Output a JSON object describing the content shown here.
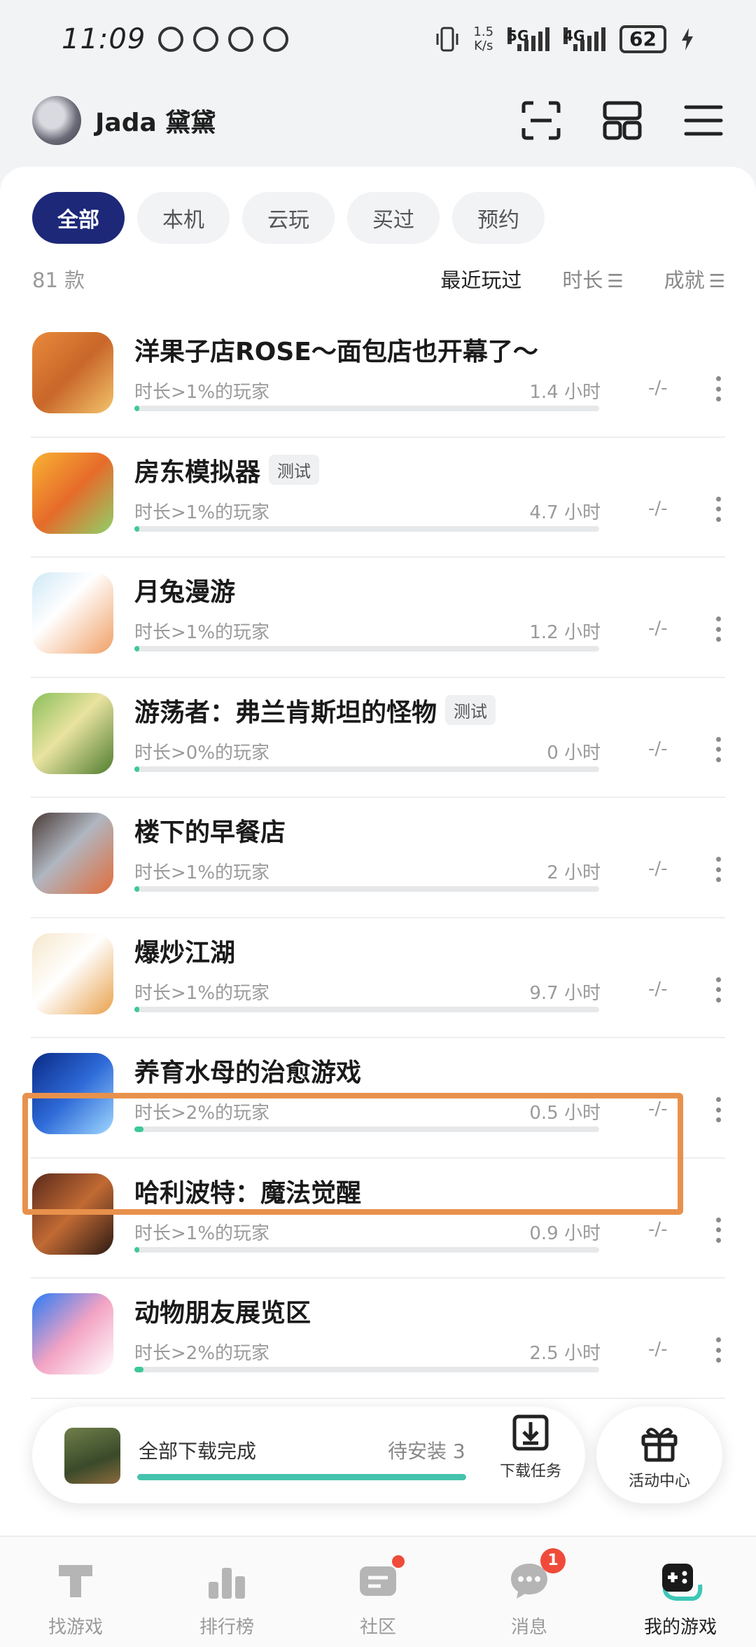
{
  "status_bar": {
    "time": "11:09",
    "net_speed_value": "1.5",
    "net_speed_unit": "K/s",
    "signal_1": "5G",
    "signal_2": "4G",
    "battery": "62"
  },
  "header": {
    "user_name": "Jada 黛黛"
  },
  "filters": [
    "全部",
    "本机",
    "云玩",
    "买过",
    "预约"
  ],
  "list_meta": {
    "count": "81 款",
    "sort_recent": "最近玩过",
    "sort_duration": "时长",
    "sort_achievement": "成就"
  },
  "games": [
    {
      "title": "洋果子店ROSE～面包店也开幕了～",
      "tag": "",
      "sub": "时长>1%的玩家",
      "hours": "1.4 小时",
      "ach": "-/-",
      "progress": 0.01
    },
    {
      "title": "房东模拟器",
      "tag": "测试",
      "sub": "时长>1%的玩家",
      "hours": "4.7 小时",
      "ach": "-/-",
      "progress": 0.01
    },
    {
      "title": "月兔漫游",
      "tag": "",
      "sub": "时长>1%的玩家",
      "hours": "1.2 小时",
      "ach": "-/-",
      "progress": 0.01
    },
    {
      "title": "游荡者：弗兰肯斯坦的怪物",
      "tag": "测试",
      "sub": "时长>0%的玩家",
      "hours": "0 小时",
      "ach": "-/-",
      "progress": 0.0
    },
    {
      "title": "楼下的早餐店",
      "tag": "",
      "sub": "时长>1%的玩家",
      "hours": "2 小时",
      "ach": "-/-",
      "progress": 0.01
    },
    {
      "title": "爆炒江湖",
      "tag": "",
      "sub": "时长>1%的玩家",
      "hours": "9.7 小时",
      "ach": "-/-",
      "progress": 0.01
    },
    {
      "title": "养育水母的治愈游戏",
      "tag": "",
      "sub": "时长>2%的玩家",
      "hours": "0.5 小时",
      "ach": "-/-",
      "progress": 0.02
    },
    {
      "title": "哈利波特：魔法觉醒",
      "tag": "",
      "sub": "时长>1%的玩家",
      "hours": "0.9 小时",
      "ach": "-/-",
      "progress": 0.01
    },
    {
      "title": "动物朋友展览区",
      "tag": "",
      "sub": "时长>2%的玩家",
      "hours": "2.5 小时",
      "ach": "-/-",
      "progress": 0.02
    }
  ],
  "download_bar": {
    "title": "全部下载完成",
    "pending": "待安装 3",
    "task_label": "下载任务",
    "progress": 1.0
  },
  "activity": {
    "label": "活动中心"
  },
  "bottom_nav": [
    {
      "label": "找游戏",
      "icon": "find-games-icon"
    },
    {
      "label": "排行榜",
      "icon": "ranking-icon"
    },
    {
      "label": "社区",
      "icon": "community-icon"
    },
    {
      "label": "消息",
      "icon": "message-icon",
      "badge": "1"
    },
    {
      "label": "我的游戏",
      "icon": "my-games-icon"
    }
  ],
  "colors": {
    "accent": "#1d2879",
    "progress": "#3dc79a",
    "highlight": "#e8914c",
    "badge": "#f04b3a"
  }
}
